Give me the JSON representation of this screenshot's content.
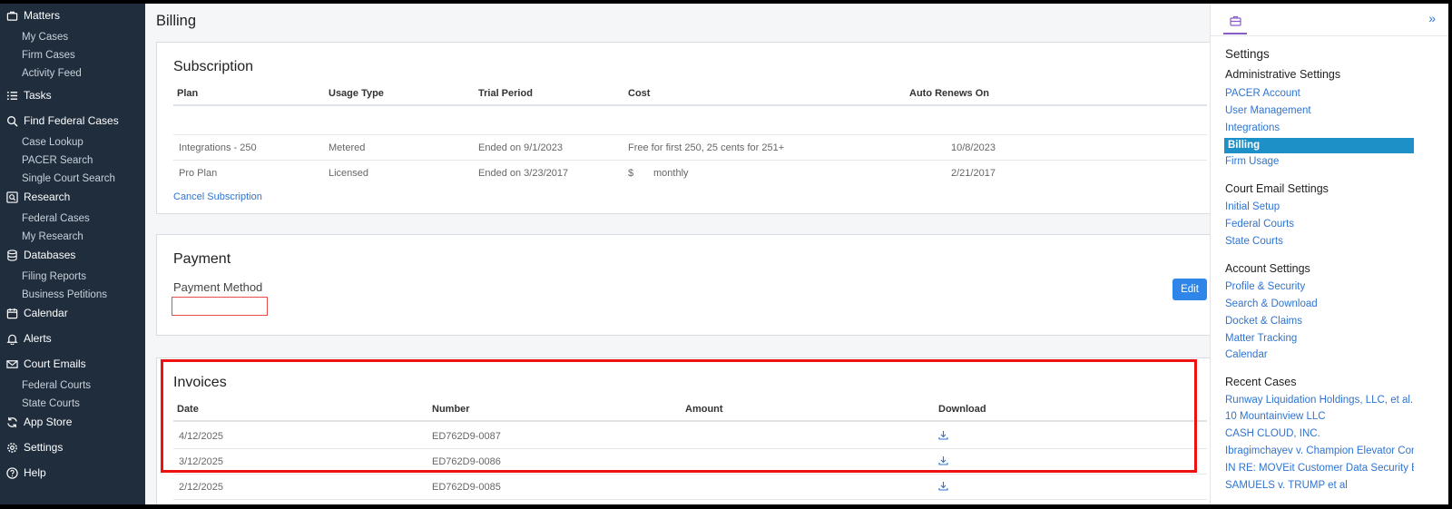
{
  "nav": {
    "matters": "Matters",
    "my_cases": "My Cases",
    "firm_cases": "Firm Cases",
    "activity_feed": "Activity Feed",
    "tasks": "Tasks",
    "find_federal_cases": "Find Federal Cases",
    "case_lookup": "Case Lookup",
    "pacer_search": "PACER Search",
    "single_court_search": "Single Court Search",
    "research": "Research",
    "federal_cases": "Federal Cases",
    "my_research": "My Research",
    "databases": "Databases",
    "filing_reports": "Filing Reports",
    "business_petitions": "Business Petitions",
    "calendar": "Calendar",
    "alerts": "Alerts",
    "court_emails": "Court Emails",
    "federal_courts": "Federal Courts",
    "state_courts": "State Courts",
    "app_store": "App Store",
    "settings": "Settings",
    "help": "Help"
  },
  "main": {
    "title": "Billing",
    "subscription": {
      "heading": "Subscription",
      "headers": [
        "Plan",
        "Usage Type",
        "Trial Period",
        "Cost",
        "Auto Renews On"
      ],
      "rows": [
        {
          "plan": "Integrations - 250",
          "usage": "Metered",
          "trial": "Ended on 9/1/2023",
          "cost": "Free for first 250, 25 cents for 251+",
          "cost_extra": "",
          "renews": "10/8/2023"
        },
        {
          "plan": "Pro Plan",
          "usage": "Licensed",
          "trial": "Ended on 3/23/2017",
          "cost": "$",
          "cost_extra": "monthly",
          "renews": "2/21/2017"
        }
      ],
      "cancel_link": "Cancel Subscription"
    },
    "payment": {
      "heading": "Payment",
      "method_label": "Payment Method",
      "edit_button": "Edit"
    },
    "invoices": {
      "heading": "Invoices",
      "headers": [
        "Date",
        "Number",
        "Amount",
        "Download"
      ],
      "rows": [
        {
          "date": "4/12/2025",
          "number": "ED762D9-0087",
          "amount": ""
        },
        {
          "date": "3/12/2025",
          "number": "ED762D9-0086",
          "amount": ""
        },
        {
          "date": "2/12/2025",
          "number": "ED762D9-0085",
          "amount": ""
        }
      ]
    }
  },
  "right_panel": {
    "settings_title": "Settings",
    "admin_heading": "Administrative Settings",
    "admin_items": [
      "PACER Account",
      "User Management",
      "Integrations",
      "Billing",
      "Firm Usage"
    ],
    "court_email_heading": "Court Email Settings",
    "court_email_items": [
      "Initial Setup",
      "Federal Courts",
      "State Courts"
    ],
    "account_heading": "Account Settings",
    "account_items": [
      "Profile & Security",
      "Search & Download",
      "Docket & Claims",
      "Matter Tracking",
      "Calendar"
    ],
    "recent_heading": "Recent Cases",
    "recent_items": [
      "Runway Liquidation Holdings, LLC, et al.",
      "10 Mountainview LLC",
      "CASH CLOUD, INC.",
      "Ibragimchayev v. Champion Elevator Const...",
      "IN RE: MOVEit Customer Data Security Bre...",
      "SAMUELS v. TRUMP et al"
    ]
  },
  "colors": {
    "nav_bg": "#1f2d3d",
    "link": "#2f74d0",
    "active_bg": "#1e90c8",
    "highlight": "#e11111",
    "edit_button": "#2f86e8"
  }
}
